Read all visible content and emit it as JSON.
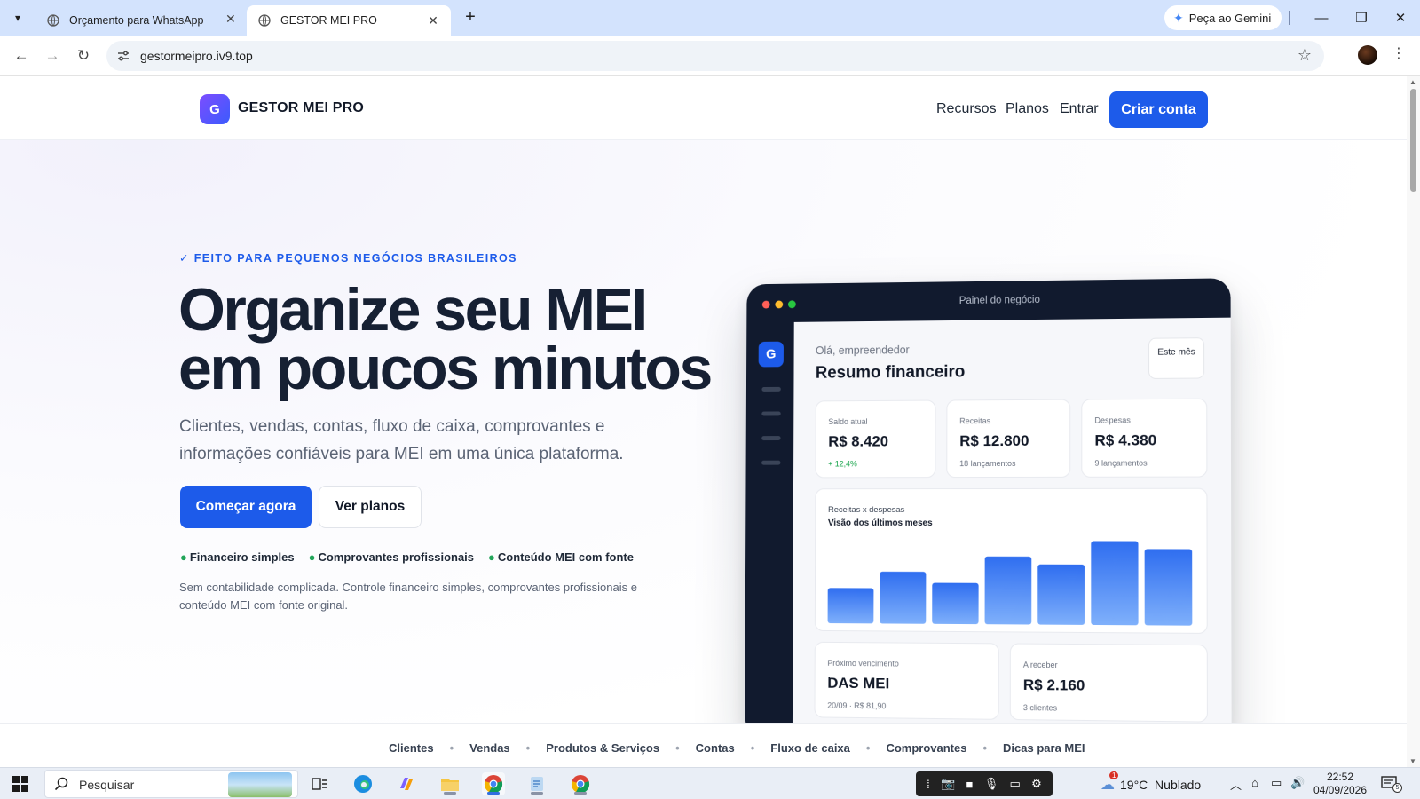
{
  "browser": {
    "tabs": [
      {
        "title": "Orçamento para WhatsApp",
        "active": false
      },
      {
        "title": "GESTOR MEI PRO",
        "active": true
      }
    ],
    "gemini_label": "Peça ao Gemini",
    "url": "gestormeipro.iv9.top"
  },
  "header": {
    "logo_letter": "G",
    "brand": "GESTOR MEI PRO",
    "nav": [
      "Recursos",
      "Planos",
      "Entrar"
    ],
    "cta": "Criar conta"
  },
  "hero": {
    "eyebrow": "✓ FEITO PARA PEQUENOS NEGÓCIOS BRASILEIROS",
    "headline_line1": "Organize seu MEI",
    "headline_line2": "em poucos minutos",
    "subtitle": "Clientes, vendas, contas, fluxo de caixa, comprovantes e informações confiáveis para MEI em uma única plataforma.",
    "primary_button": "Começar agora",
    "secondary_button": "Ver planos",
    "bullets": [
      "Financeiro simples",
      "Comprovantes profissionais",
      "Conteúdo MEI com fonte"
    ],
    "note": "Sem contabilidade complicada. Controle financeiro simples, comprovantes profissionais e conteúdo MEI com fonte original."
  },
  "dashboard": {
    "window_title": "Painel do negócio",
    "logo_letter": "G",
    "greeting": "Olá, empreendedor",
    "title": "Resumo financeiro",
    "period": "Este mês",
    "cards": [
      {
        "label": "Saldo atual",
        "value": "R$ 8.420",
        "meta": "+ 12,4%"
      },
      {
        "label": "Receitas",
        "value": "R$ 12.800",
        "meta": "18 lançamentos"
      },
      {
        "label": "Despesas",
        "value": "R$ 4.380",
        "meta": "9 lançamentos"
      }
    ],
    "chart_label": "Receitas x despesas",
    "chart_title": "Visão dos últimos meses",
    "bottom_cards": [
      {
        "label": "Próximo vencimento",
        "value": "DAS MEI",
        "meta": "20/09 · R$ 81,90"
      },
      {
        "label": "A receber",
        "value": "R$ 2.160",
        "meta": "3 clientes"
      }
    ]
  },
  "chart_data": {
    "type": "bar",
    "title": "Visão dos últimos meses",
    "subtitle": "Receitas x despesas",
    "categories": [
      "",
      "",
      "",
      "",
      "",
      "",
      ""
    ],
    "values": [
      32,
      47,
      37,
      61,
      54,
      75,
      68
    ],
    "ylim": [
      0,
      80
    ],
    "grid": false,
    "color": "#3b7af5"
  },
  "subnav": [
    "Clientes",
    "Vendas",
    "Produtos & Serviços",
    "Contas",
    "Fluxo de caixa",
    "Comprovantes",
    "Dicas para MEI"
  ],
  "taskbar": {
    "search_placeholder": "Pesquisar",
    "weather": "19°C  Nublado",
    "weather_badge": "1",
    "time": "22:52",
    "date": "04/09/2026",
    "notification_count": "5"
  }
}
